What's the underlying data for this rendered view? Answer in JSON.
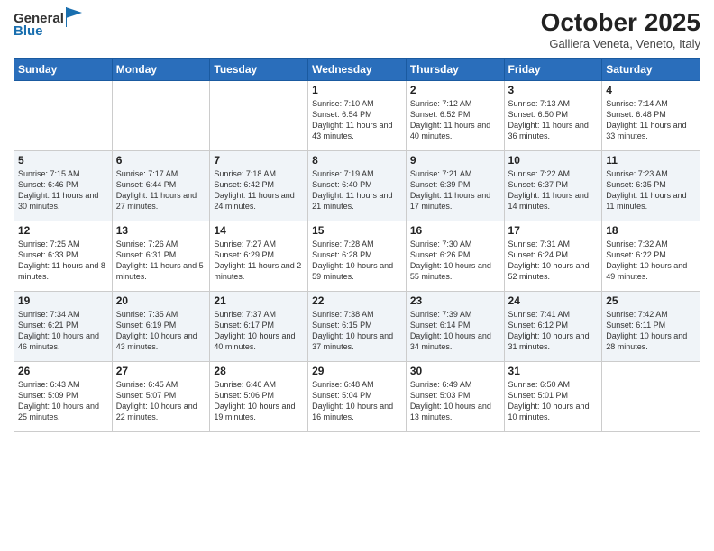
{
  "header": {
    "logo_line1": "General",
    "logo_line2": "Blue",
    "month_title": "October 2025",
    "location": "Galliera Veneta, Veneto, Italy"
  },
  "weekdays": [
    "Sunday",
    "Monday",
    "Tuesday",
    "Wednesday",
    "Thursday",
    "Friday",
    "Saturday"
  ],
  "weeks": [
    [
      {
        "day": "",
        "info": ""
      },
      {
        "day": "",
        "info": ""
      },
      {
        "day": "",
        "info": ""
      },
      {
        "day": "1",
        "info": "Sunrise: 7:10 AM\nSunset: 6:54 PM\nDaylight: 11 hours and 43 minutes."
      },
      {
        "day": "2",
        "info": "Sunrise: 7:12 AM\nSunset: 6:52 PM\nDaylight: 11 hours and 40 minutes."
      },
      {
        "day": "3",
        "info": "Sunrise: 7:13 AM\nSunset: 6:50 PM\nDaylight: 11 hours and 36 minutes."
      },
      {
        "day": "4",
        "info": "Sunrise: 7:14 AM\nSunset: 6:48 PM\nDaylight: 11 hours and 33 minutes."
      }
    ],
    [
      {
        "day": "5",
        "info": "Sunrise: 7:15 AM\nSunset: 6:46 PM\nDaylight: 11 hours and 30 minutes."
      },
      {
        "day": "6",
        "info": "Sunrise: 7:17 AM\nSunset: 6:44 PM\nDaylight: 11 hours and 27 minutes."
      },
      {
        "day": "7",
        "info": "Sunrise: 7:18 AM\nSunset: 6:42 PM\nDaylight: 11 hours and 24 minutes."
      },
      {
        "day": "8",
        "info": "Sunrise: 7:19 AM\nSunset: 6:40 PM\nDaylight: 11 hours and 21 minutes."
      },
      {
        "day": "9",
        "info": "Sunrise: 7:21 AM\nSunset: 6:39 PM\nDaylight: 11 hours and 17 minutes."
      },
      {
        "day": "10",
        "info": "Sunrise: 7:22 AM\nSunset: 6:37 PM\nDaylight: 11 hours and 14 minutes."
      },
      {
        "day": "11",
        "info": "Sunrise: 7:23 AM\nSunset: 6:35 PM\nDaylight: 11 hours and 11 minutes."
      }
    ],
    [
      {
        "day": "12",
        "info": "Sunrise: 7:25 AM\nSunset: 6:33 PM\nDaylight: 11 hours and 8 minutes."
      },
      {
        "day": "13",
        "info": "Sunrise: 7:26 AM\nSunset: 6:31 PM\nDaylight: 11 hours and 5 minutes."
      },
      {
        "day": "14",
        "info": "Sunrise: 7:27 AM\nSunset: 6:29 PM\nDaylight: 11 hours and 2 minutes."
      },
      {
        "day": "15",
        "info": "Sunrise: 7:28 AM\nSunset: 6:28 PM\nDaylight: 10 hours and 59 minutes."
      },
      {
        "day": "16",
        "info": "Sunrise: 7:30 AM\nSunset: 6:26 PM\nDaylight: 10 hours and 55 minutes."
      },
      {
        "day": "17",
        "info": "Sunrise: 7:31 AM\nSunset: 6:24 PM\nDaylight: 10 hours and 52 minutes."
      },
      {
        "day": "18",
        "info": "Sunrise: 7:32 AM\nSunset: 6:22 PM\nDaylight: 10 hours and 49 minutes."
      }
    ],
    [
      {
        "day": "19",
        "info": "Sunrise: 7:34 AM\nSunset: 6:21 PM\nDaylight: 10 hours and 46 minutes."
      },
      {
        "day": "20",
        "info": "Sunrise: 7:35 AM\nSunset: 6:19 PM\nDaylight: 10 hours and 43 minutes."
      },
      {
        "day": "21",
        "info": "Sunrise: 7:37 AM\nSunset: 6:17 PM\nDaylight: 10 hours and 40 minutes."
      },
      {
        "day": "22",
        "info": "Sunrise: 7:38 AM\nSunset: 6:15 PM\nDaylight: 10 hours and 37 minutes."
      },
      {
        "day": "23",
        "info": "Sunrise: 7:39 AM\nSunset: 6:14 PM\nDaylight: 10 hours and 34 minutes."
      },
      {
        "day": "24",
        "info": "Sunrise: 7:41 AM\nSunset: 6:12 PM\nDaylight: 10 hours and 31 minutes."
      },
      {
        "day": "25",
        "info": "Sunrise: 7:42 AM\nSunset: 6:11 PM\nDaylight: 10 hours and 28 minutes."
      }
    ],
    [
      {
        "day": "26",
        "info": "Sunrise: 6:43 AM\nSunset: 5:09 PM\nDaylight: 10 hours and 25 minutes."
      },
      {
        "day": "27",
        "info": "Sunrise: 6:45 AM\nSunset: 5:07 PM\nDaylight: 10 hours and 22 minutes."
      },
      {
        "day": "28",
        "info": "Sunrise: 6:46 AM\nSunset: 5:06 PM\nDaylight: 10 hours and 19 minutes."
      },
      {
        "day": "29",
        "info": "Sunrise: 6:48 AM\nSunset: 5:04 PM\nDaylight: 10 hours and 16 minutes."
      },
      {
        "day": "30",
        "info": "Sunrise: 6:49 AM\nSunset: 5:03 PM\nDaylight: 10 hours and 13 minutes."
      },
      {
        "day": "31",
        "info": "Sunrise: 6:50 AM\nSunset: 5:01 PM\nDaylight: 10 hours and 10 minutes."
      },
      {
        "day": "",
        "info": ""
      }
    ]
  ]
}
